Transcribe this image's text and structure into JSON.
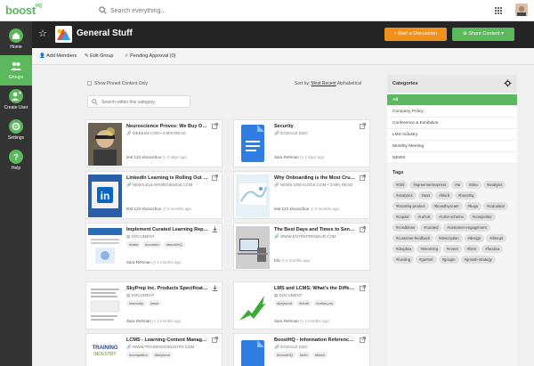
{
  "topbar": {
    "logo_main": "boost",
    "logo_suffix": "HQ",
    "search_placeholder": "Search everything..."
  },
  "sidebar": {
    "items": [
      {
        "label": "Home"
      },
      {
        "label": "Groups"
      },
      {
        "label": "Create User"
      },
      {
        "label": "Settings"
      },
      {
        "label": "Help"
      }
    ]
  },
  "header": {
    "title": "General Stuff",
    "start_discussion": "Start a Discussion",
    "share_content": "Share Content"
  },
  "actions": {
    "add_members": "Add Members",
    "edit_group": "Edit Group",
    "pending_approval": "Pending Approval (0)"
  },
  "filters": {
    "show_pinned": "Show Pinned Content Only",
    "sort_by": "Sort by:",
    "most_recent": "Most Recent",
    "alphabetical": "Alphabetical",
    "search_placeholder": "Search within this category"
  },
  "cards": [
    {
      "title": "Neuroscience Proves: We Buy On ...",
      "source": "MEDIUM.COM • 3 MIN READ",
      "user": "test 123 shooochoo",
      "time": "2 days ago",
      "tags": []
    },
    {
      "title": "Security",
      "source": "GOOGLE DOC",
      "user": "Sara Rehman",
      "time": "2 days ago",
      "tags": []
    },
    {
      "title": "LinkedIn Learning is Rolling Out Th...",
      "source": "NEWS.ELEARNINGINSIDE.COM",
      "user": "test 123 shooochoo",
      "time": "2 months ago",
      "tags": []
    },
    {
      "title": "Why Onboarding is the Most Cruci...",
      "source": "NEWS.GREYLOCK.COM • 3 MIN READ",
      "user": "test 123 shooochoo",
      "time": "2 months ago",
      "tags": []
    },
    {
      "title": "Implement Curated Learning Report",
      "source": "DOCUMENT",
      "user": "Sara Rehman",
      "time": "2 months ago",
      "tags": [
        "#data",
        "#curated",
        "#boostHQ"
      ]
    },
    {
      "title": "The Best Days and Times to Send ...",
      "source": "WWW.ENTREPRENEUR.COM",
      "user": "Kla",
      "time": "2 months ago",
      "tags": []
    },
    {
      "title": "SkyPrep Inc. Products Specificatio...",
      "source": "DOCUMENT",
      "user": "Sara Rehman",
      "time": "2 months ago",
      "tags": [
        "#security",
        "#aws"
      ]
    },
    {
      "title": "LMS and LCMS: What's the Differe...",
      "source": "DOCUMENT",
      "user": "Sara Rehman",
      "time": "2 months ago",
      "tags": [
        "#keyword",
        "#blurb",
        "#value-pro"
      ]
    },
    {
      "title": "LCMS - Learning Content Manage...",
      "source": "WWW.TRAININGINDUSTRY.COM",
      "user": "",
      "time": "",
      "tags": [
        "#competitor",
        "#keyword"
      ]
    },
    {
      "title": "BoostHQ - Information Reference ...",
      "source": "GOOGLE DOC",
      "user": "",
      "time": "",
      "tags": [
        "#boostHQ",
        "#info",
        "#blurb"
      ]
    }
  ],
  "categories": {
    "heading": "Categories",
    "items": [
      "All",
      "Company Policy",
      "Conference & Exhibition",
      "LMS Industry",
      "Monthly Meeting",
      "NEWS"
    ]
  },
  "tags": {
    "heading": "Tags",
    "items": [
      "#020",
      "#agreementexpress",
      "#ai",
      "#alex",
      "#analysis",
      "#analytics",
      "#aws",
      "#blurb",
      "#boosthq",
      "#boosthq-product",
      "#boosthq-team",
      "#bugs",
      "#calculator",
      "#capital",
      "#cohort",
      "#color-scheme",
      "#competitor",
      "#conditions",
      "#curated",
      "#customer-engagement",
      "#customer-feedback",
      "#description",
      "#design",
      "#disrupt",
      "#dropbox",
      "#elearning",
      "#event",
      "#form",
      "#fundica",
      "#funding",
      "#gartner",
      "#google",
      "#growth-strategy"
    ]
  },
  "colors": {
    "brand_green": "#5cb85c",
    "orange": "#f0901d",
    "dark": "#252525"
  }
}
